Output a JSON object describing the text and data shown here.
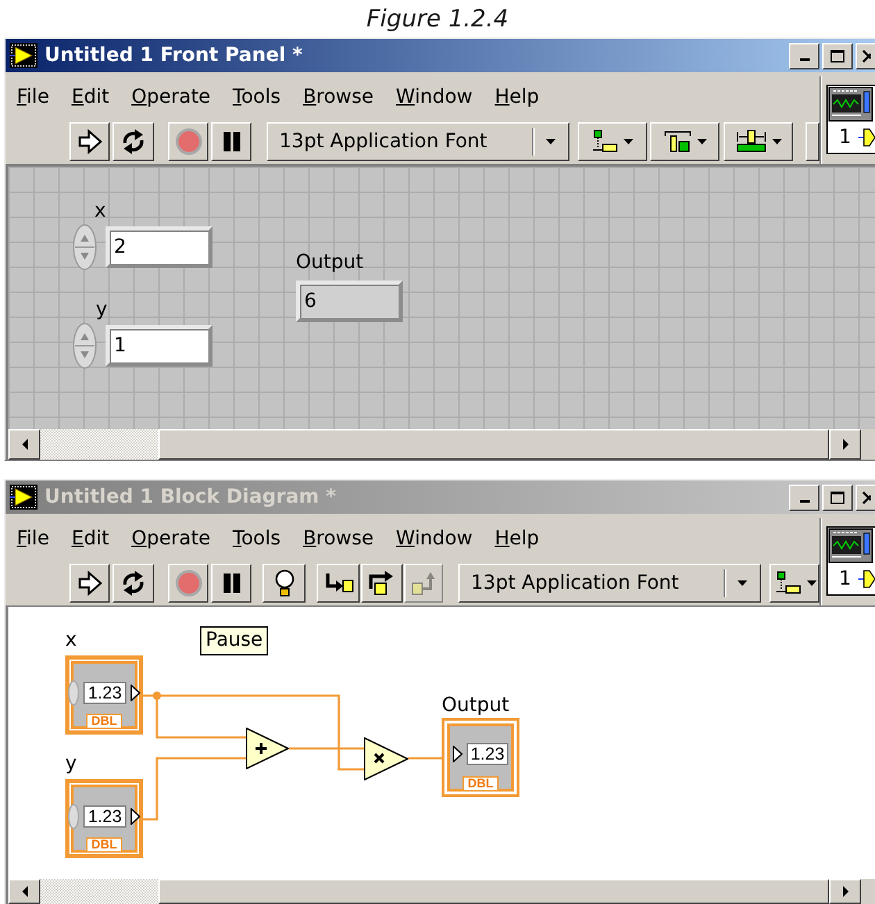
{
  "caption": "Figure 1.2.4",
  "front_panel": {
    "title": "Untitled 1 Front Panel *",
    "active": true,
    "menu": [
      "File",
      "Edit",
      "Operate",
      "Tools",
      "Browse",
      "Window",
      "Help"
    ],
    "toolbar": [
      {
        "kind": "run",
        "disabled": false
      },
      {
        "kind": "run_continuously",
        "disabled": false
      },
      {
        "kind": "abort",
        "disabled": false
      },
      {
        "kind": "pause",
        "disabled": false
      },
      {
        "kind": "font",
        "value": "13pt Application Font",
        "disabled": false
      },
      {
        "kind": "align",
        "disabled": false
      },
      {
        "kind": "distribute",
        "disabled": false
      },
      {
        "kind": "resize",
        "disabled": false
      },
      {
        "kind": "partial",
        "disabled": false
      }
    ],
    "vi_icon": {
      "number": "1"
    },
    "controls": [
      {
        "kind": "control",
        "label": "x",
        "value": "2"
      },
      {
        "kind": "control",
        "label": "y",
        "value": "1"
      },
      {
        "kind": "indicator",
        "label": "Output",
        "value": "6"
      }
    ]
  },
  "block_diagram": {
    "title": "Untitled 1 Block Diagram *",
    "active": false,
    "menu": [
      "File",
      "Edit",
      "Operate",
      "Tools",
      "Browse",
      "Window",
      "Help"
    ],
    "toolbar": [
      {
        "kind": "run",
        "disabled": false
      },
      {
        "kind": "run_continuously",
        "disabled": false
      },
      {
        "kind": "abort",
        "disabled": false
      },
      {
        "kind": "pause",
        "disabled": false
      },
      {
        "kind": "highlight",
        "disabled": false
      },
      {
        "kind": "step_into",
        "disabled": false
      },
      {
        "kind": "step_over",
        "disabled": false
      },
      {
        "kind": "step_out",
        "disabled": true
      },
      {
        "kind": "font",
        "value": "13pt Application Font",
        "disabled": false
      },
      {
        "kind": "align",
        "disabled": false
      }
    ],
    "vi_icon": {
      "number": "1"
    },
    "tooltip": "Pause",
    "terminals": [
      {
        "kind": "control",
        "label": "x",
        "value": "1.23",
        "type": "DBL"
      },
      {
        "kind": "control",
        "label": "y",
        "value": "1.23",
        "type": "DBL"
      },
      {
        "kind": "indicator",
        "label": "Output",
        "value": "1.23",
        "type": "DBL"
      }
    ],
    "nodes": [
      {
        "kind": "add"
      },
      {
        "kind": "multiply"
      }
    ]
  }
}
